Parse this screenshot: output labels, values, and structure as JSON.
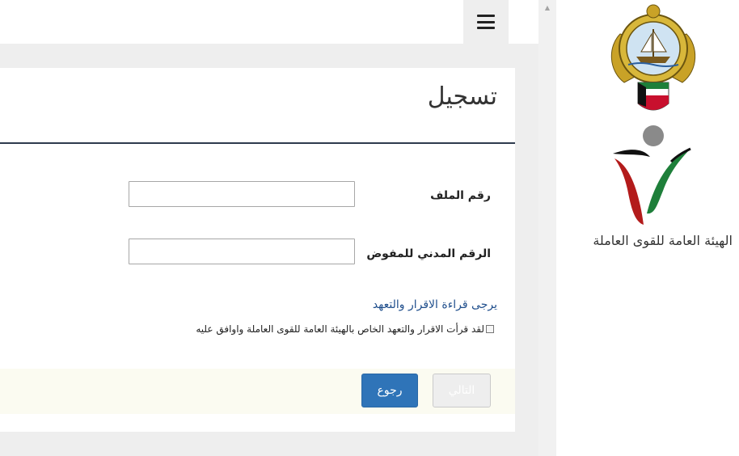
{
  "page": {
    "title": "تسجيل"
  },
  "form": {
    "file_number_label": "رقم الملف",
    "file_number_value": "",
    "civil_id_label": "الرقم المدني للمفوض",
    "civil_id_value": "",
    "notice_link": "يرجى قراءة الاقرار والتعهد",
    "agreement_label": "لقد قرأت الاقرار والتعهد الخاص بالهيئة العامة للقوى العاملة واوافق عليه",
    "agreement_checked": false
  },
  "buttons": {
    "back_label": "رجوع",
    "next_label": "التالي"
  },
  "sidebar": {
    "org_name": "الهيئة العامة للقوى العاملة",
    "emblem_icon": "kuwait-emblem-icon",
    "logo_icon": "pam-logo-icon"
  },
  "toolbar": {
    "menu_icon": "hamburger-menu-icon"
  },
  "colors": {
    "primary_button": "#2f74b8",
    "separator": "#2e3b4e",
    "link": "#1f4e8c",
    "logo_red": "#b31b1b",
    "logo_green": "#1e7f3a"
  }
}
